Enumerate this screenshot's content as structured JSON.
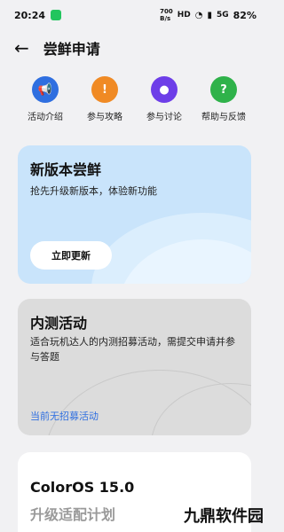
{
  "status": {
    "time": "20:24",
    "network_speed": "700\nB/s",
    "hd": "HD",
    "signal": "5G",
    "battery": "82%"
  },
  "header": {
    "back_symbol": "←",
    "title": "尝鲜申请"
  },
  "quick_actions": [
    {
      "label": "活动介绍",
      "icon": "megaphone-icon",
      "color": "#2f6fe0"
    },
    {
      "label": "参与攻略",
      "icon": "book-icon",
      "color": "#f08a24"
    },
    {
      "label": "参与讨论",
      "icon": "chat-icon",
      "color": "#6d3ee8"
    },
    {
      "label": "帮助与反馈",
      "icon": "help-icon",
      "color": "#2fb24a"
    }
  ],
  "new_version_card": {
    "title": "新版本尝鲜",
    "subtitle": "抢先升级新版本，体验新功能",
    "button": "立即更新"
  },
  "test_card": {
    "title": "内测活动",
    "description": "适合玩机达人的内测招募活动，需提交申请并参与答题",
    "status": "当前无招募活动"
  },
  "os_card": {
    "title": "ColorOS 15.0",
    "subtitle": "升级适配计划"
  },
  "watermark": "九鼎软件园"
}
